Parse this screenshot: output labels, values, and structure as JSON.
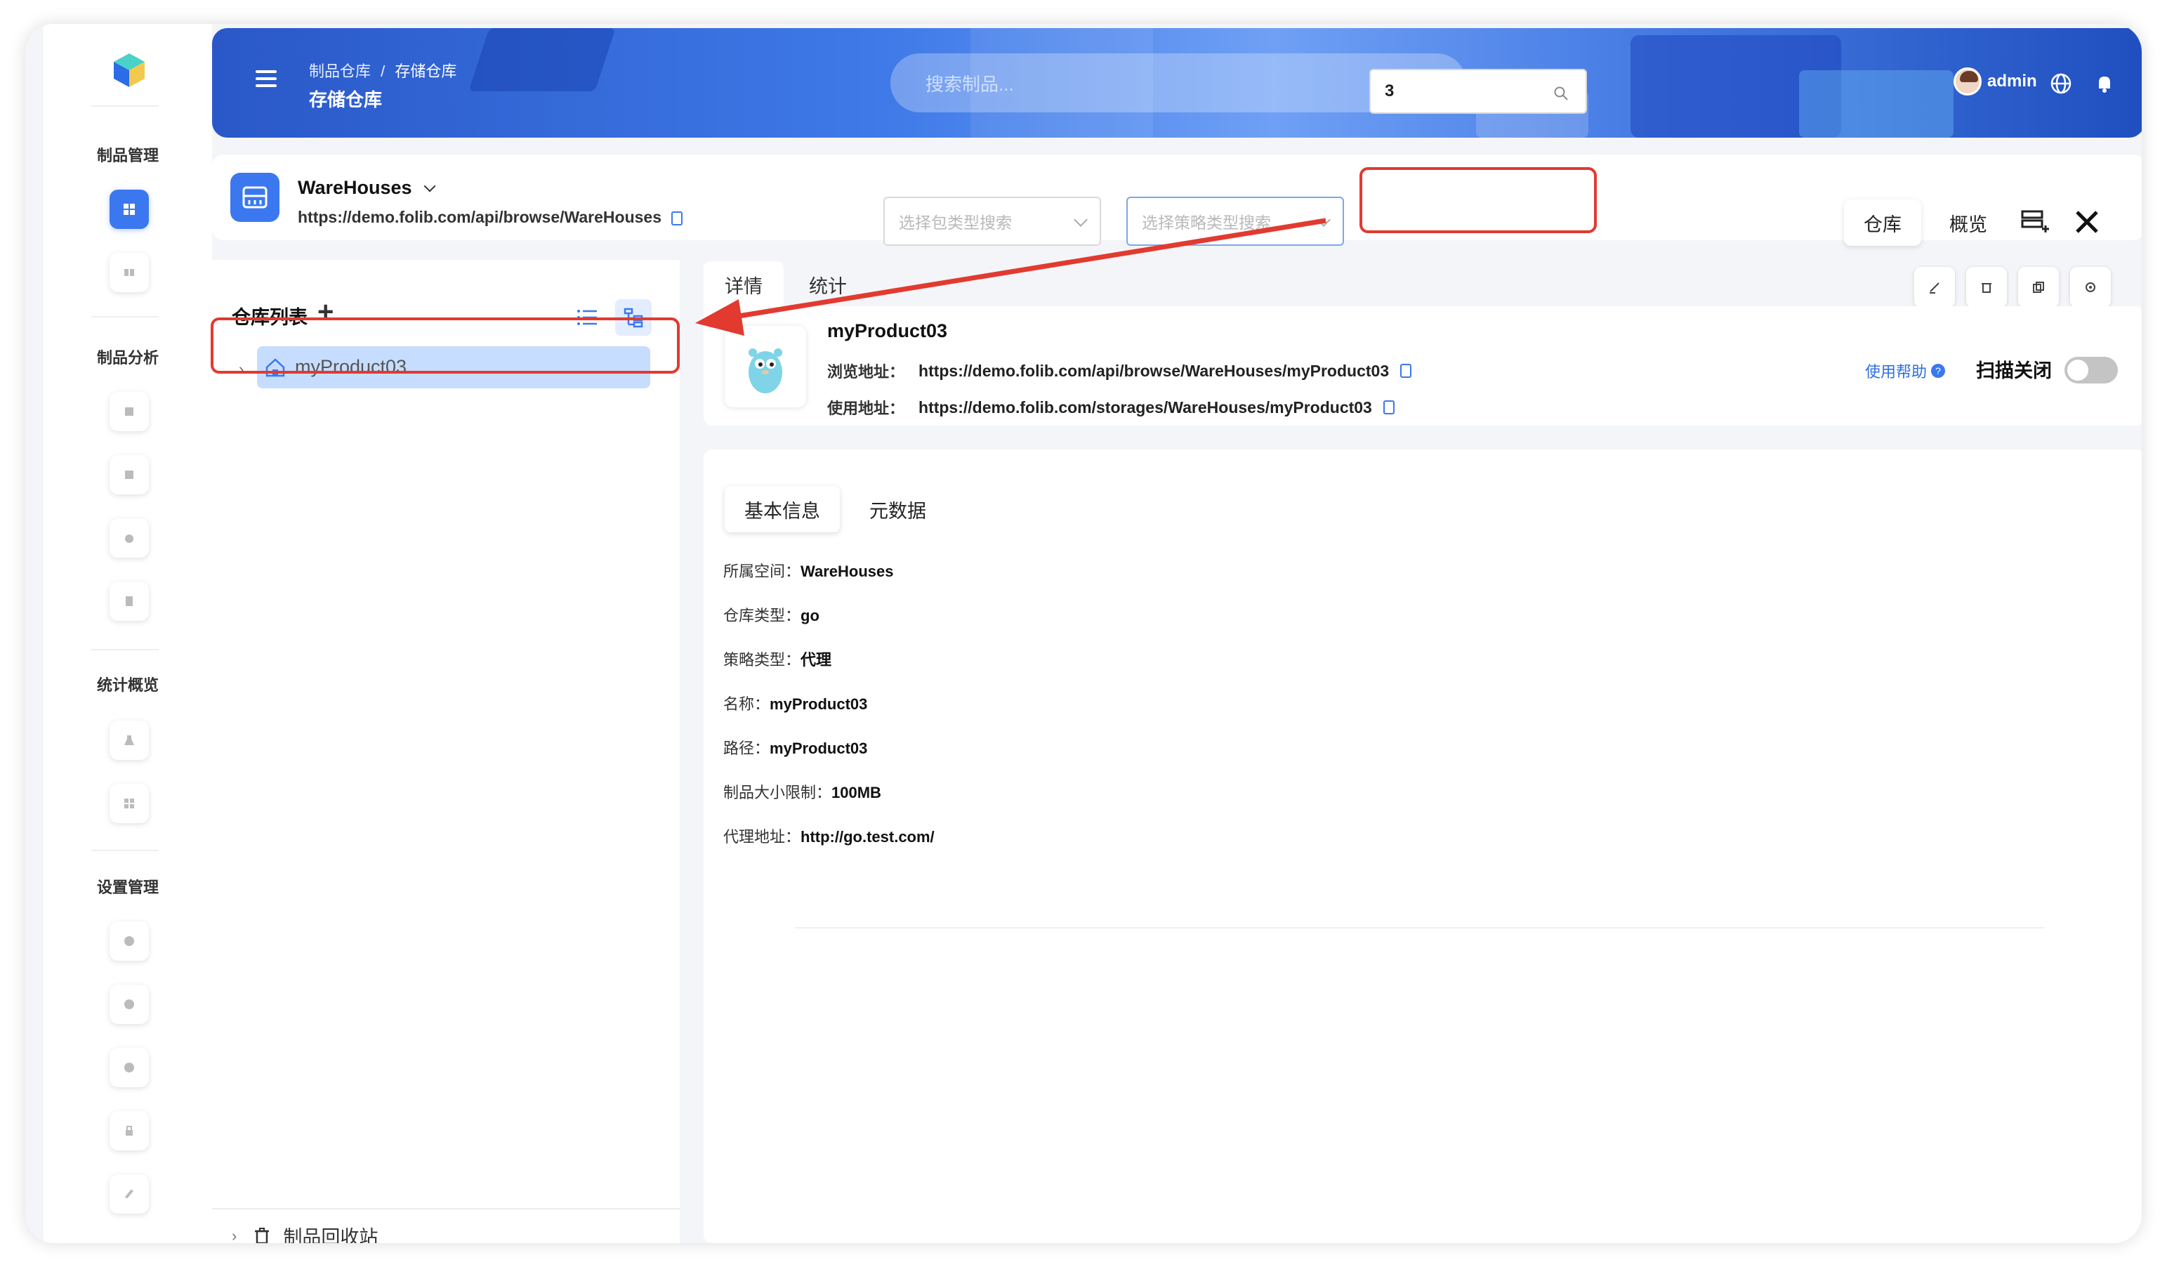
{
  "sidebar": {
    "sections": [
      "制品管理",
      "制品分析",
      "统计概览",
      "设置管理"
    ]
  },
  "header": {
    "breadcrumb_parent": "制品仓库",
    "breadcrumb_sep": "/",
    "breadcrumb_current": "存储仓库",
    "title": "存储仓库",
    "search_placeholder": "搜索制品...",
    "user": "admin"
  },
  "repobar": {
    "name": "WareHouses",
    "url": "https://demo.folib.com/api/browse/WareHouses",
    "package_type_placeholder": "选择包类型搜索",
    "policy_type_placeholder": "选择策略类型搜索",
    "search_value": "3",
    "tabs": [
      "仓库",
      "概览"
    ]
  },
  "left_panel": {
    "title": "仓库列表",
    "add": "+",
    "tree_items": [
      "myProduct03"
    ],
    "recycle": "制品回收站"
  },
  "detail": {
    "tabs": [
      "详情",
      "统计"
    ],
    "name": "myProduct03",
    "browse_label": "浏览地址：",
    "browse_url": "https://demo.folib.com/api/browse/WareHouses/myProduct03",
    "use_label": "使用地址：",
    "use_url": "https://demo.folib.com/storages/WareHouses/myProduct03",
    "help": "使用帮助",
    "help_q": "?",
    "scan": "扫描关闭",
    "sub_tabs": [
      "基本信息",
      "元数据"
    ],
    "fields": [
      {
        "k": "所属空间：",
        "v": "WareHouses"
      },
      {
        "k": "仓库类型：",
        "v": "go"
      },
      {
        "k": "策略类型：",
        "v": "代理"
      },
      {
        "k": "名称：",
        "v": "myProduct03"
      },
      {
        "k": "路径：",
        "v": "myProduct03"
      },
      {
        "k": "制品大小限制：",
        "v": "100MB"
      },
      {
        "k": "代理地址：",
        "v": "http://go.test.com/"
      }
    ]
  },
  "colors": {
    "accent": "#3b78f0",
    "highlight": "#e23a2f",
    "selection": "#c7ddff"
  }
}
